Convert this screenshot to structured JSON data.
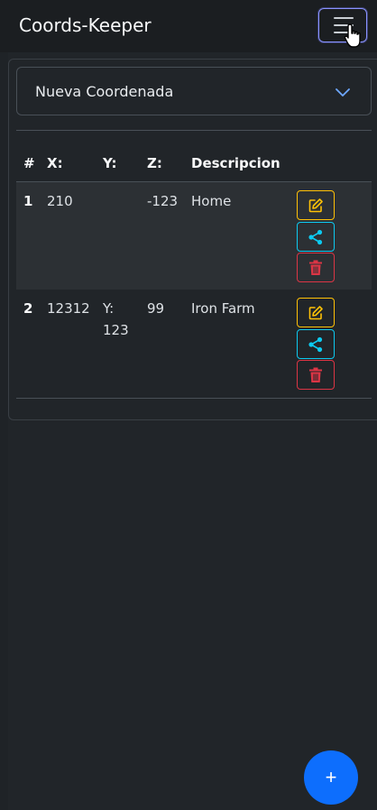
{
  "app": {
    "title": "Coords-Keeper"
  },
  "form": {
    "select_value": "Nueva Coordenada"
  },
  "table": {
    "headers": [
      "#",
      "X:",
      "Y:",
      "Z:",
      "Descripcion"
    ],
    "rows": [
      {
        "num": "1",
        "x": "210",
        "y": "",
        "z": "-123",
        "desc": "Home"
      },
      {
        "num": "2",
        "x": "12312",
        "y": "Y: 123",
        "z": "99",
        "desc": "Iron Farm"
      }
    ]
  },
  "fab": {
    "label": "+"
  },
  "colors": {
    "edit": "#ffc107",
    "share": "#0dcaf0",
    "delete": "#dc3545",
    "primary": "#0d6efd"
  },
  "icons": [
    "hamburger-menu-icon",
    "pointer-cursor-icon",
    "chevron-down-icon",
    "edit-icon",
    "share-icon",
    "trash-icon"
  ]
}
